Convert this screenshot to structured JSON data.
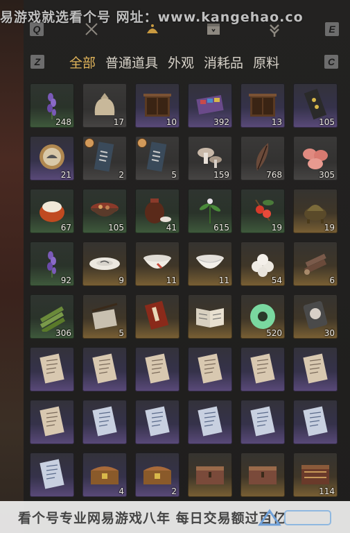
{
  "watermark_top": "易游戏就选看个号  网址：www.kangehao.co",
  "watermark_bottom": "看个号专业网易游戏八年 每日交易额过百亿",
  "keycaps": {
    "q": "Q",
    "e": "E",
    "z": "Z",
    "c": "C"
  },
  "categories": [
    {
      "label": "全部",
      "active": true
    },
    {
      "label": "普通道具",
      "active": false
    },
    {
      "label": "外观",
      "active": false
    },
    {
      "label": "消耗品",
      "active": false
    },
    {
      "label": "原料",
      "active": false
    }
  ],
  "items": [
    {
      "icon": "lavender-icon",
      "quality": "green",
      "count": "248"
    },
    {
      "icon": "sack-icon",
      "quality": "gray",
      "count": "17"
    },
    {
      "icon": "cabinet-icon",
      "quality": "purple",
      "count": "10"
    },
    {
      "icon": "dye-box-icon",
      "quality": "purple",
      "count": "392"
    },
    {
      "icon": "cabinet-icon",
      "quality": "purple",
      "count": "13"
    },
    {
      "icon": "talisman-pack-icon",
      "quality": "purple",
      "count": "105"
    },
    {
      "icon": "bird-token-icon",
      "quality": "purple",
      "count": "21"
    },
    {
      "icon": "ticket-icon",
      "quality": "gray",
      "count": "2",
      "timed": true
    },
    {
      "icon": "ticket-icon",
      "quality": "gray",
      "count": "5",
      "timed": true
    },
    {
      "icon": "mushroom-icon",
      "quality": "gray",
      "count": "159"
    },
    {
      "icon": "feather-icon",
      "quality": "gray",
      "count": "768"
    },
    {
      "icon": "meat-icon",
      "quality": "gray",
      "count": "305"
    },
    {
      "icon": "chestnut-icon",
      "quality": "green",
      "count": "67"
    },
    {
      "icon": "stew-bowl-icon",
      "quality": "green",
      "count": "105"
    },
    {
      "icon": "wine-jar-icon",
      "quality": "green",
      "count": "41"
    },
    {
      "icon": "herb-icon",
      "quality": "green",
      "count": "615"
    },
    {
      "icon": "berry-icon",
      "quality": "green",
      "count": "19"
    },
    {
      "icon": "incense-burner-icon",
      "quality": "gold",
      "count": "19"
    },
    {
      "icon": "lavender-icon",
      "quality": "green",
      "count": "92"
    },
    {
      "icon": "plate-icon",
      "quality": "gold",
      "count": "9"
    },
    {
      "icon": "rooster-bowl-icon",
      "quality": "gold",
      "count": "11"
    },
    {
      "icon": "bowl-icon",
      "quality": "gold",
      "count": "11"
    },
    {
      "icon": "rice-balls-icon",
      "quality": "gold",
      "count": "54"
    },
    {
      "icon": "logs-icon",
      "quality": "gold",
      "count": "6"
    },
    {
      "icon": "bamboo-icon",
      "quality": "green",
      "count": "306"
    },
    {
      "icon": "brush-paper-icon",
      "quality": "gold",
      "count": "5"
    },
    {
      "icon": "red-book-icon",
      "quality": "gold",
      "count": ""
    },
    {
      "icon": "open-book-icon",
      "quality": "gold",
      "count": ""
    },
    {
      "icon": "jade-disc-icon",
      "quality": "gold",
      "count": "520"
    },
    {
      "icon": "seal-tag-icon",
      "quality": "gold",
      "count": "30"
    },
    {
      "icon": "letter-icon",
      "quality": "purple",
      "count": ""
    },
    {
      "icon": "letter-icon",
      "quality": "purple",
      "count": ""
    },
    {
      "icon": "letter-icon",
      "quality": "purple",
      "count": ""
    },
    {
      "icon": "letter-icon",
      "quality": "purple",
      "count": ""
    },
    {
      "icon": "letter-icon",
      "quality": "purple",
      "count": ""
    },
    {
      "icon": "letter-icon",
      "quality": "purple",
      "count": ""
    },
    {
      "icon": "letter-icon",
      "quality": "purple",
      "count": ""
    },
    {
      "icon": "blue-letter-icon",
      "quality": "purple",
      "count": ""
    },
    {
      "icon": "blue-letter-icon",
      "quality": "purple",
      "count": ""
    },
    {
      "icon": "blue-letter-icon",
      "quality": "purple",
      "count": ""
    },
    {
      "icon": "blue-letter-icon",
      "quality": "purple",
      "count": ""
    },
    {
      "icon": "blue-letter-icon",
      "quality": "purple",
      "count": ""
    },
    {
      "icon": "blue-letter-icon",
      "quality": "purple",
      "count": ""
    },
    {
      "icon": "treasure-chest-icon",
      "quality": "purple",
      "count": "4"
    },
    {
      "icon": "treasure-chest-icon",
      "quality": "purple",
      "count": "2"
    },
    {
      "icon": "wooden-chest-icon",
      "quality": "gold",
      "count": ""
    },
    {
      "icon": "wooden-chest-icon",
      "quality": "gold",
      "count": ""
    },
    {
      "icon": "ornate-chest-icon",
      "quality": "gold",
      "count": "114"
    }
  ],
  "colors": {
    "active_category": "#e0b45a",
    "text": "#d7d2c8"
  }
}
